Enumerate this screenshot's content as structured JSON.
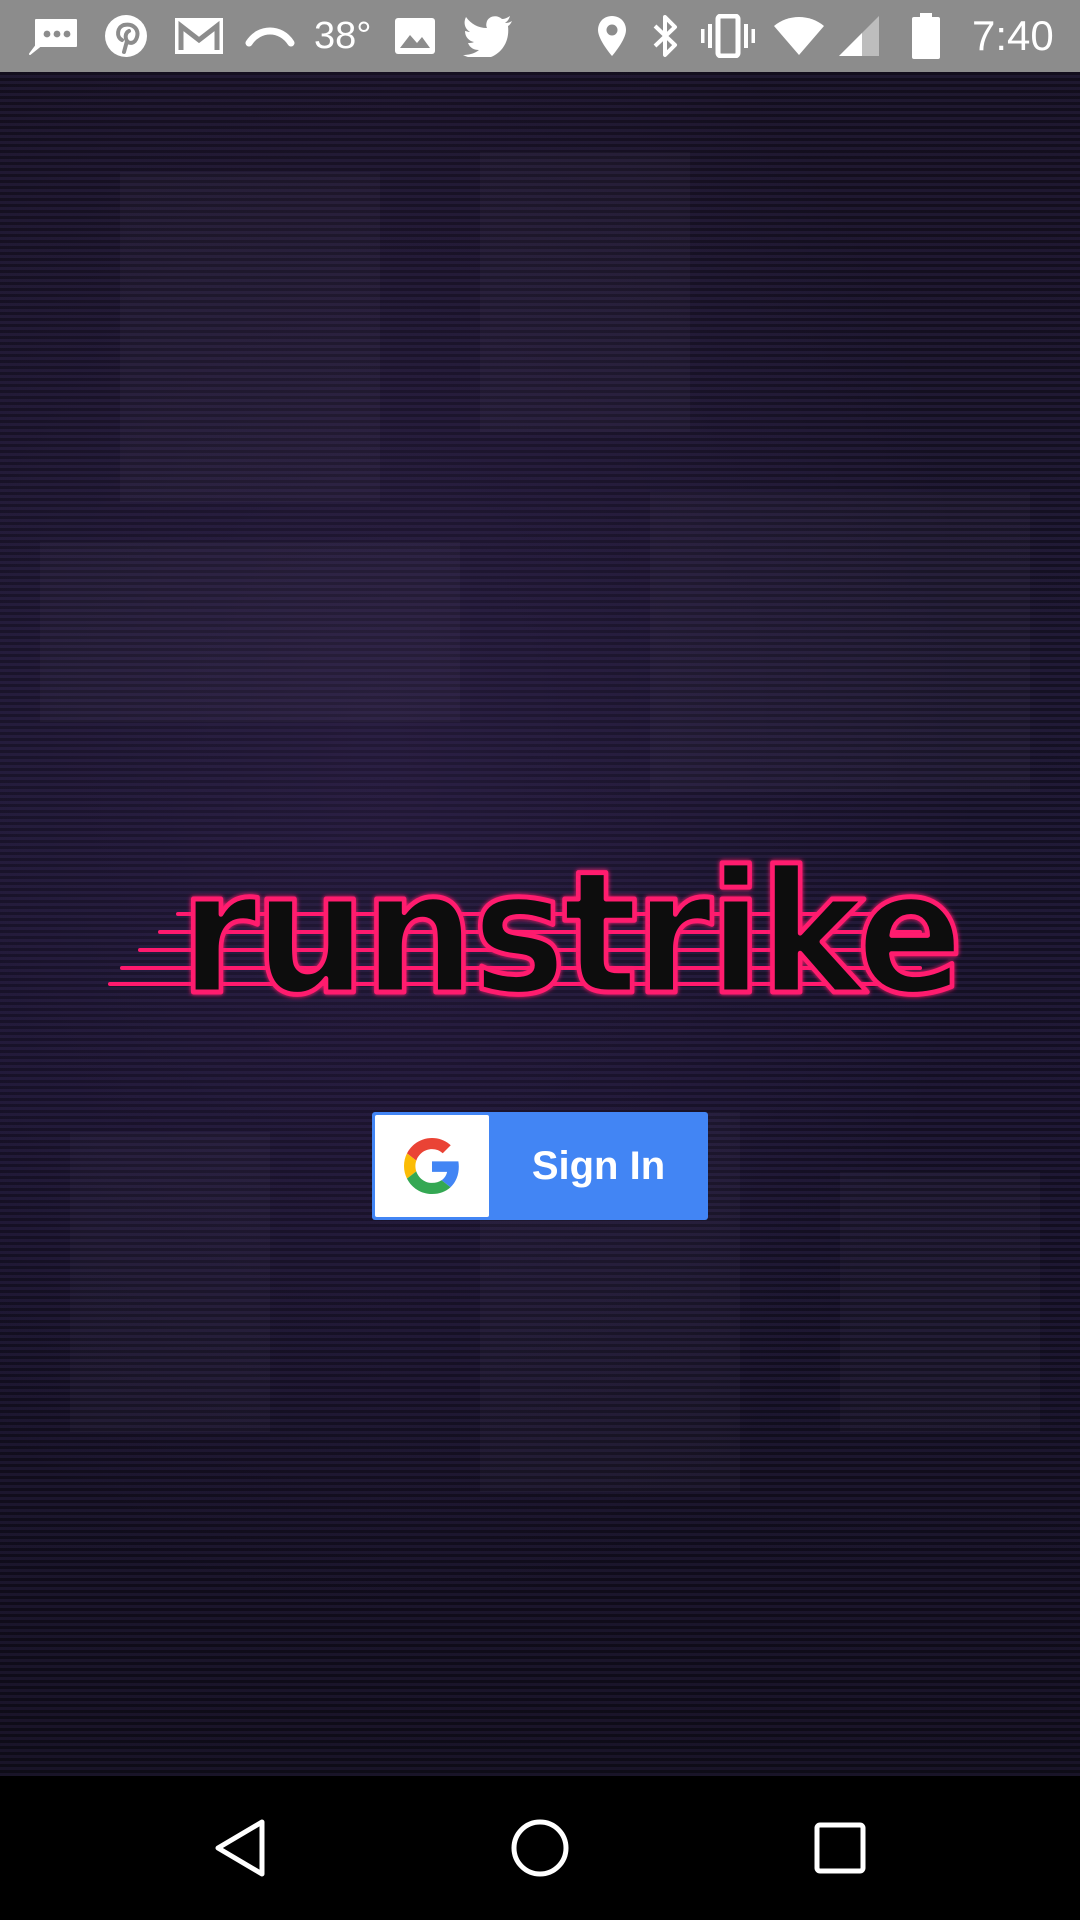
{
  "status_bar": {
    "temperature": "38°",
    "time": "7:40",
    "icons": [
      "messages-icon",
      "pinterest-icon",
      "gmail-icon",
      "cast-icon",
      "image-icon",
      "twitter-icon",
      "location-icon",
      "bluetooth-icon",
      "vibrate-icon",
      "wifi-icon",
      "signal-icon",
      "battery-icon"
    ]
  },
  "app": {
    "logo_text": "runstrike",
    "logo_color": "#ff1a6e"
  },
  "signin": {
    "label": "Sign In",
    "provider_icon": "google-g-icon",
    "button_color": "#4285f4"
  },
  "nav_bar": {
    "icons": [
      "back-icon",
      "home-icon",
      "recents-icon"
    ]
  }
}
